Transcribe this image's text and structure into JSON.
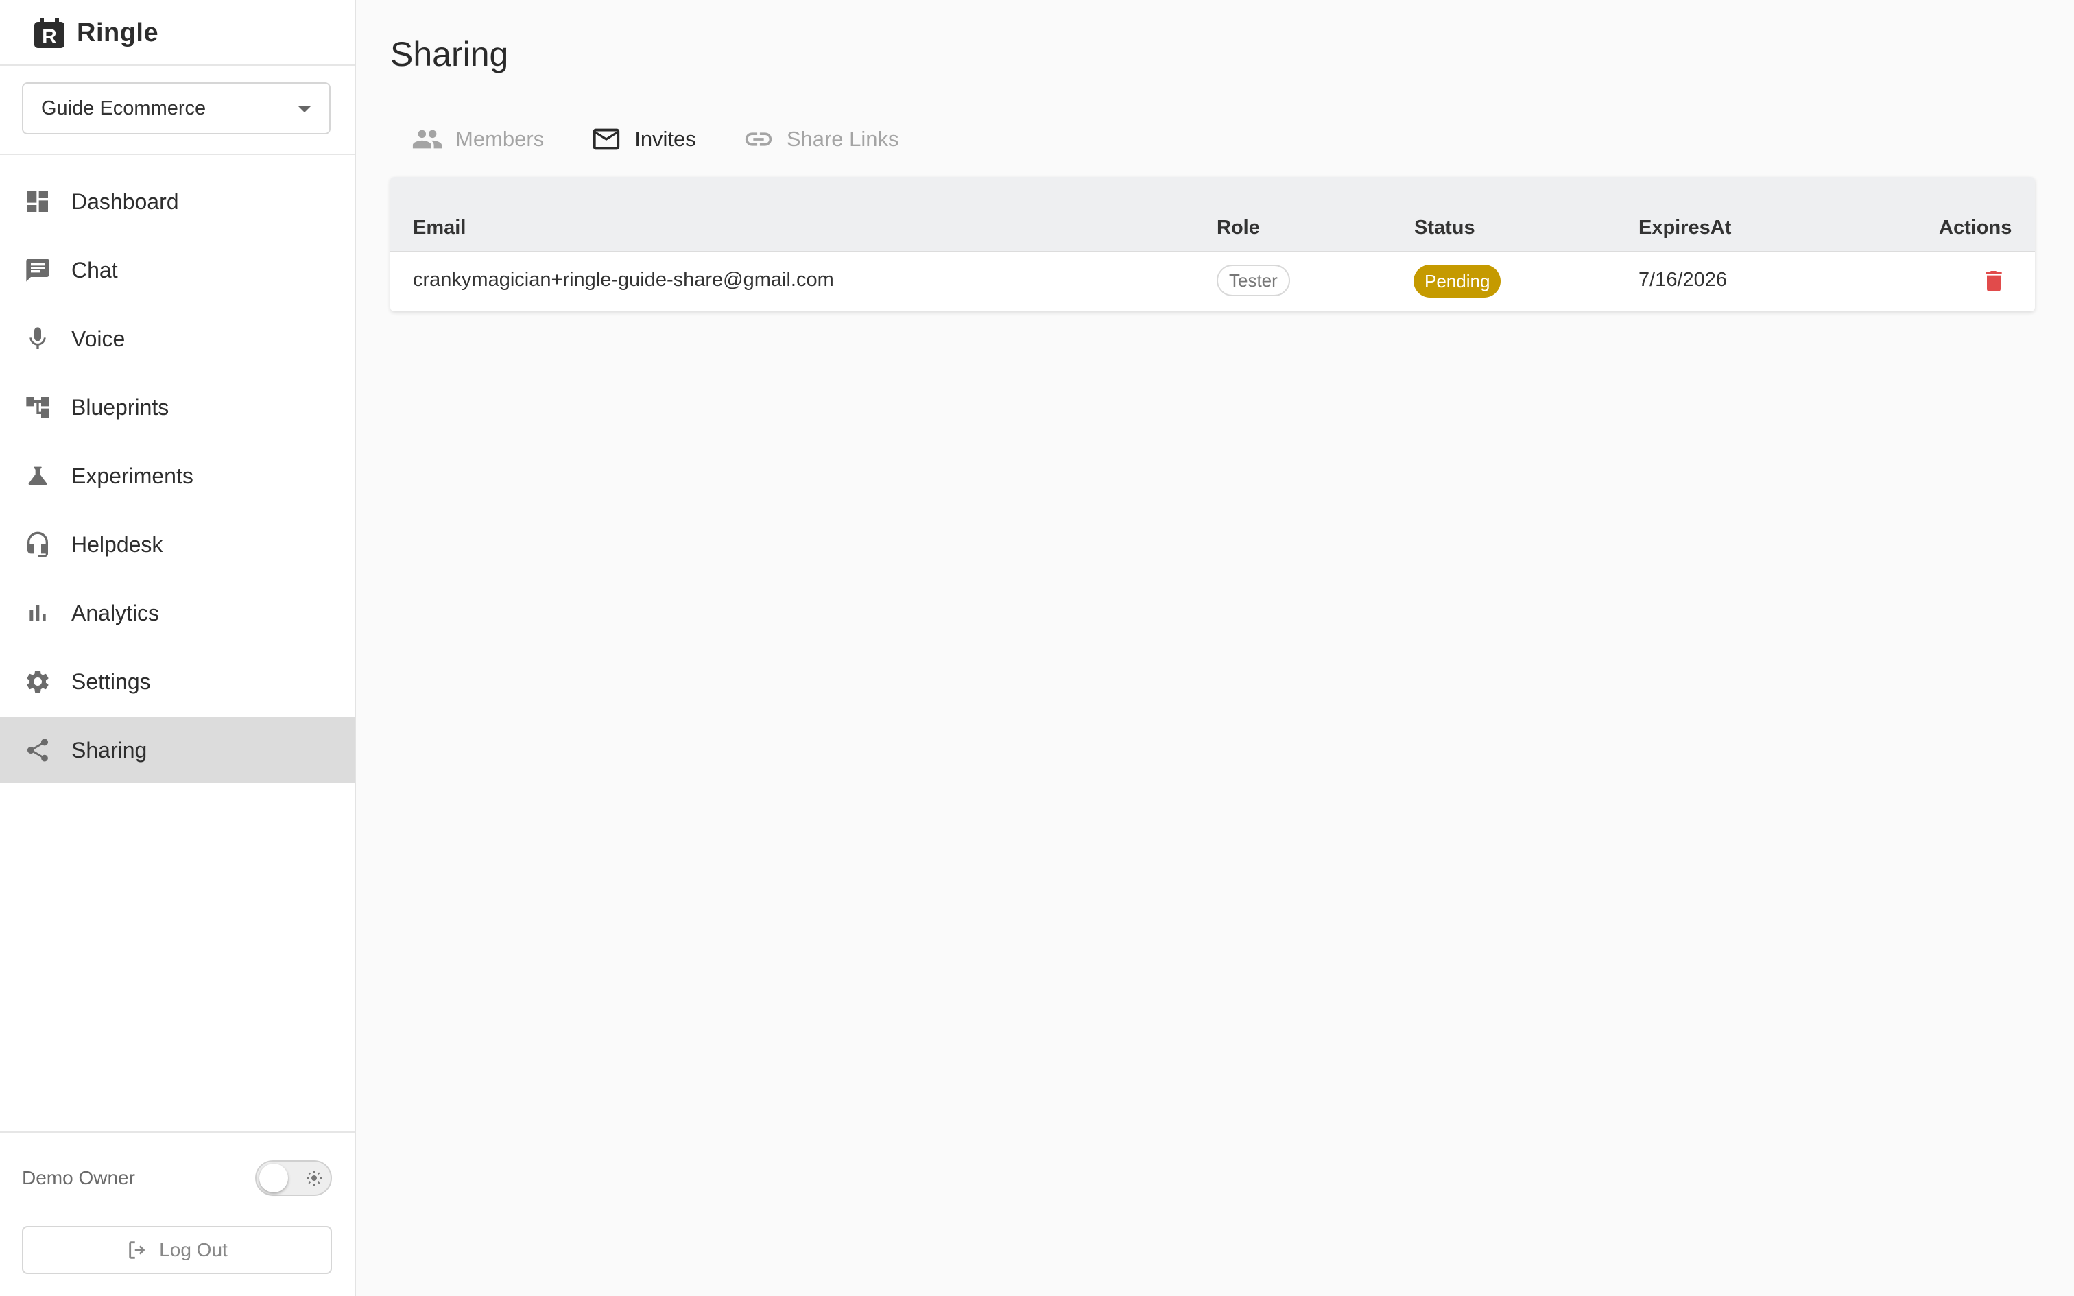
{
  "app": {
    "name": "Ringle"
  },
  "workspace": {
    "selected": "Guide Ecommerce"
  },
  "sidebar": {
    "items": [
      {
        "label": "Dashboard",
        "icon": "dashboard-icon"
      },
      {
        "label": "Chat",
        "icon": "chat-icon"
      },
      {
        "label": "Voice",
        "icon": "microphone-icon"
      },
      {
        "label": "Blueprints",
        "icon": "blueprints-icon"
      },
      {
        "label": "Experiments",
        "icon": "flask-icon"
      },
      {
        "label": "Helpdesk",
        "icon": "headset-icon"
      },
      {
        "label": "Analytics",
        "icon": "bar-chart-icon"
      },
      {
        "label": "Settings",
        "icon": "gear-icon"
      },
      {
        "label": "Sharing",
        "icon": "share-icon",
        "active": true
      }
    ],
    "user": {
      "name": "Demo Owner"
    },
    "logout_label": "Log Out"
  },
  "main": {
    "title": "Sharing",
    "tabs": [
      {
        "label": "Members",
        "icon": "people-icon",
        "active": false
      },
      {
        "label": "Invites",
        "icon": "mail-icon",
        "active": true
      },
      {
        "label": "Share Links",
        "icon": "link-icon",
        "active": false
      }
    ],
    "table": {
      "headers": [
        "Email",
        "Role",
        "Status",
        "ExpiresAt",
        "Actions"
      ],
      "rows": [
        {
          "email": "crankymagician+ringle-guide-share@gmail.com",
          "role": "Tester",
          "status": "Pending",
          "expires_at": "7/16/2026"
        }
      ]
    }
  },
  "colors": {
    "accent_active_bg": "#dcdcdc",
    "status_pending": "#c59a00",
    "delete": "#e14b4b"
  }
}
